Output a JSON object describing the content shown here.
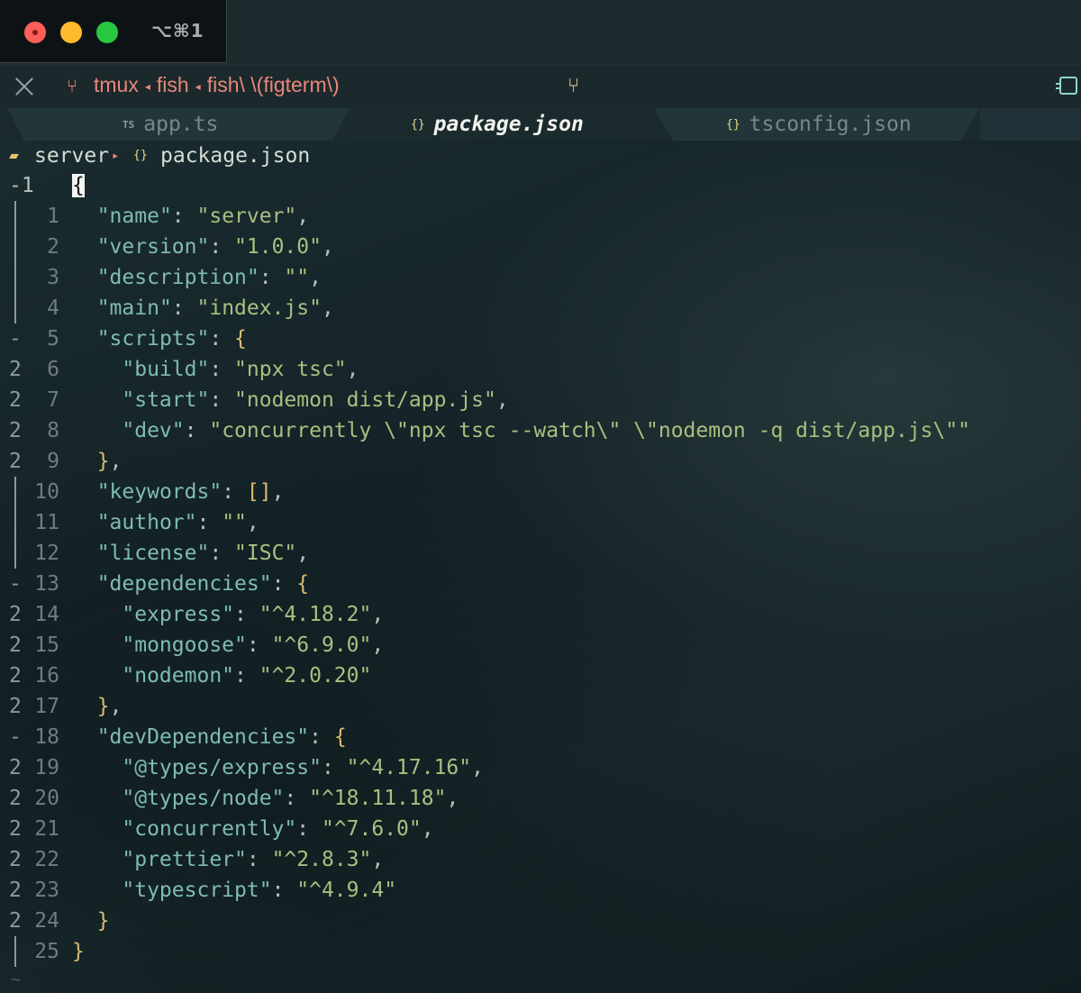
{
  "window": {
    "shortcut": "⌥⌘1"
  },
  "statusline": {
    "crumbs": [
      "tmux",
      "fish",
      "fish\\ \\(figterm\\)"
    ]
  },
  "tabs": [
    {
      "label": "app.ts",
      "icon": "TS",
      "active": false
    },
    {
      "label": "package.json",
      "icon": "{}",
      "active": true
    },
    {
      "label": "tsconfig.json",
      "icon": "{}",
      "active": false
    }
  ],
  "breadcrumb": {
    "folder": "server",
    "file": "package.json",
    "file_icon": "{}"
  },
  "editor": {
    "cursor_line_label": "-1",
    "lines": [
      {
        "fold": "",
        "num": "-1",
        "code": "{"
      },
      {
        "fold": "bar",
        "num": "1",
        "code": "  \"name\": \"server\","
      },
      {
        "fold": "bar",
        "num": "2",
        "code": "  \"version\": \"1.0.0\","
      },
      {
        "fold": "bar",
        "num": "3",
        "code": "  \"description\": \"\","
      },
      {
        "fold": "bar",
        "num": "4",
        "code": "  \"main\": \"index.js\","
      },
      {
        "fold": "-",
        "num": "5",
        "code": "  \"scripts\": {"
      },
      {
        "fold": "2",
        "num": "6",
        "code": "    \"build\": \"npx tsc\","
      },
      {
        "fold": "2",
        "num": "7",
        "code": "    \"start\": \"nodemon dist/app.js\","
      },
      {
        "fold": "2",
        "num": "8",
        "code": "    \"dev\": \"concurrently \\\"npx tsc --watch\\\" \\\"nodemon -q dist/app.js\\\"\""
      },
      {
        "fold": "2",
        "num": "9",
        "code": "  },"
      },
      {
        "fold": "bar",
        "num": "10",
        "code": "  \"keywords\": [],"
      },
      {
        "fold": "bar",
        "num": "11",
        "code": "  \"author\": \"\","
      },
      {
        "fold": "bar",
        "num": "12",
        "code": "  \"license\": \"ISC\","
      },
      {
        "fold": "-",
        "num": "13",
        "code": "  \"dependencies\": {"
      },
      {
        "fold": "2",
        "num": "14",
        "code": "    \"express\": \"^4.18.2\","
      },
      {
        "fold": "2",
        "num": "15",
        "code": "    \"mongoose\": \"^6.9.0\","
      },
      {
        "fold": "2",
        "num": "16",
        "code": "    \"nodemon\": \"^2.0.20\""
      },
      {
        "fold": "2",
        "num": "17",
        "code": "  },"
      },
      {
        "fold": "-",
        "num": "18",
        "code": "  \"devDependencies\": {"
      },
      {
        "fold": "2",
        "num": "19",
        "code": "    \"@types/express\": \"^4.17.16\","
      },
      {
        "fold": "2",
        "num": "20",
        "code": "    \"@types/node\": \"^18.11.18\","
      },
      {
        "fold": "2",
        "num": "21",
        "code": "    \"concurrently\": \"^7.6.0\","
      },
      {
        "fold": "2",
        "num": "22",
        "code": "    \"prettier\": \"^2.8.3\","
      },
      {
        "fold": "2",
        "num": "23",
        "code": "    \"typescript\": \"^4.9.4\""
      },
      {
        "fold": "2",
        "num": "24",
        "code": "  }"
      },
      {
        "fold": "bar",
        "num": "25",
        "code": "}"
      }
    ],
    "end_marker": "~"
  },
  "colors": {
    "key": "#7fbbb3",
    "string": "#a7c080",
    "brace": "#d9bb6f",
    "accent": "#e8877b"
  }
}
